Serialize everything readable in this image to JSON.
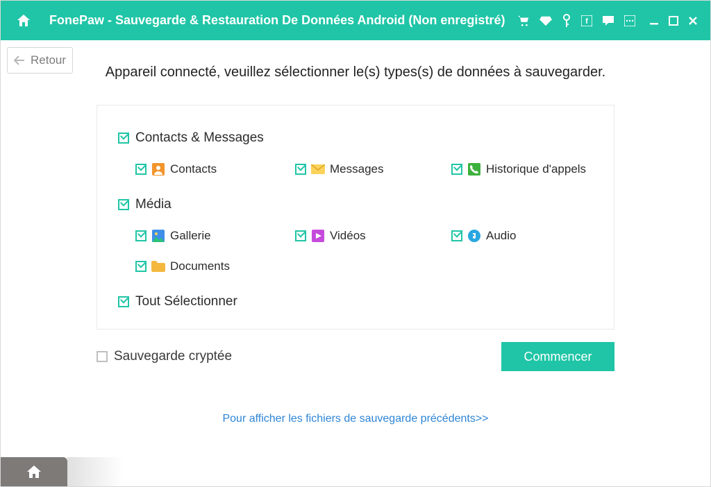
{
  "titlebar": {
    "title": "FonePaw - Sauvegarde & Restauration De Données Android (Non enregistré)"
  },
  "back": {
    "label": "Retour"
  },
  "instruction": "Appareil connecté, veuillez sélectionner le(s) types(s) de données à sauvegarder.",
  "categories": {
    "contactsMessages": {
      "label": "Contacts & Messages",
      "items": {
        "contacts": "Contacts",
        "messages": "Messages",
        "callHistory": "Historique d'appels"
      }
    },
    "media": {
      "label": "Média",
      "items": {
        "gallery": "Gallerie",
        "videos": "Vidéos",
        "audio": "Audio",
        "documents": "Documents"
      }
    },
    "selectAll": {
      "label": "Tout Sélectionner"
    }
  },
  "encrypted": {
    "label": "Sauvegarde cryptée"
  },
  "start": {
    "label": "Commencer"
  },
  "prevLink": {
    "label": "Pour afficher les fichiers de sauvegarde précédents>>"
  }
}
